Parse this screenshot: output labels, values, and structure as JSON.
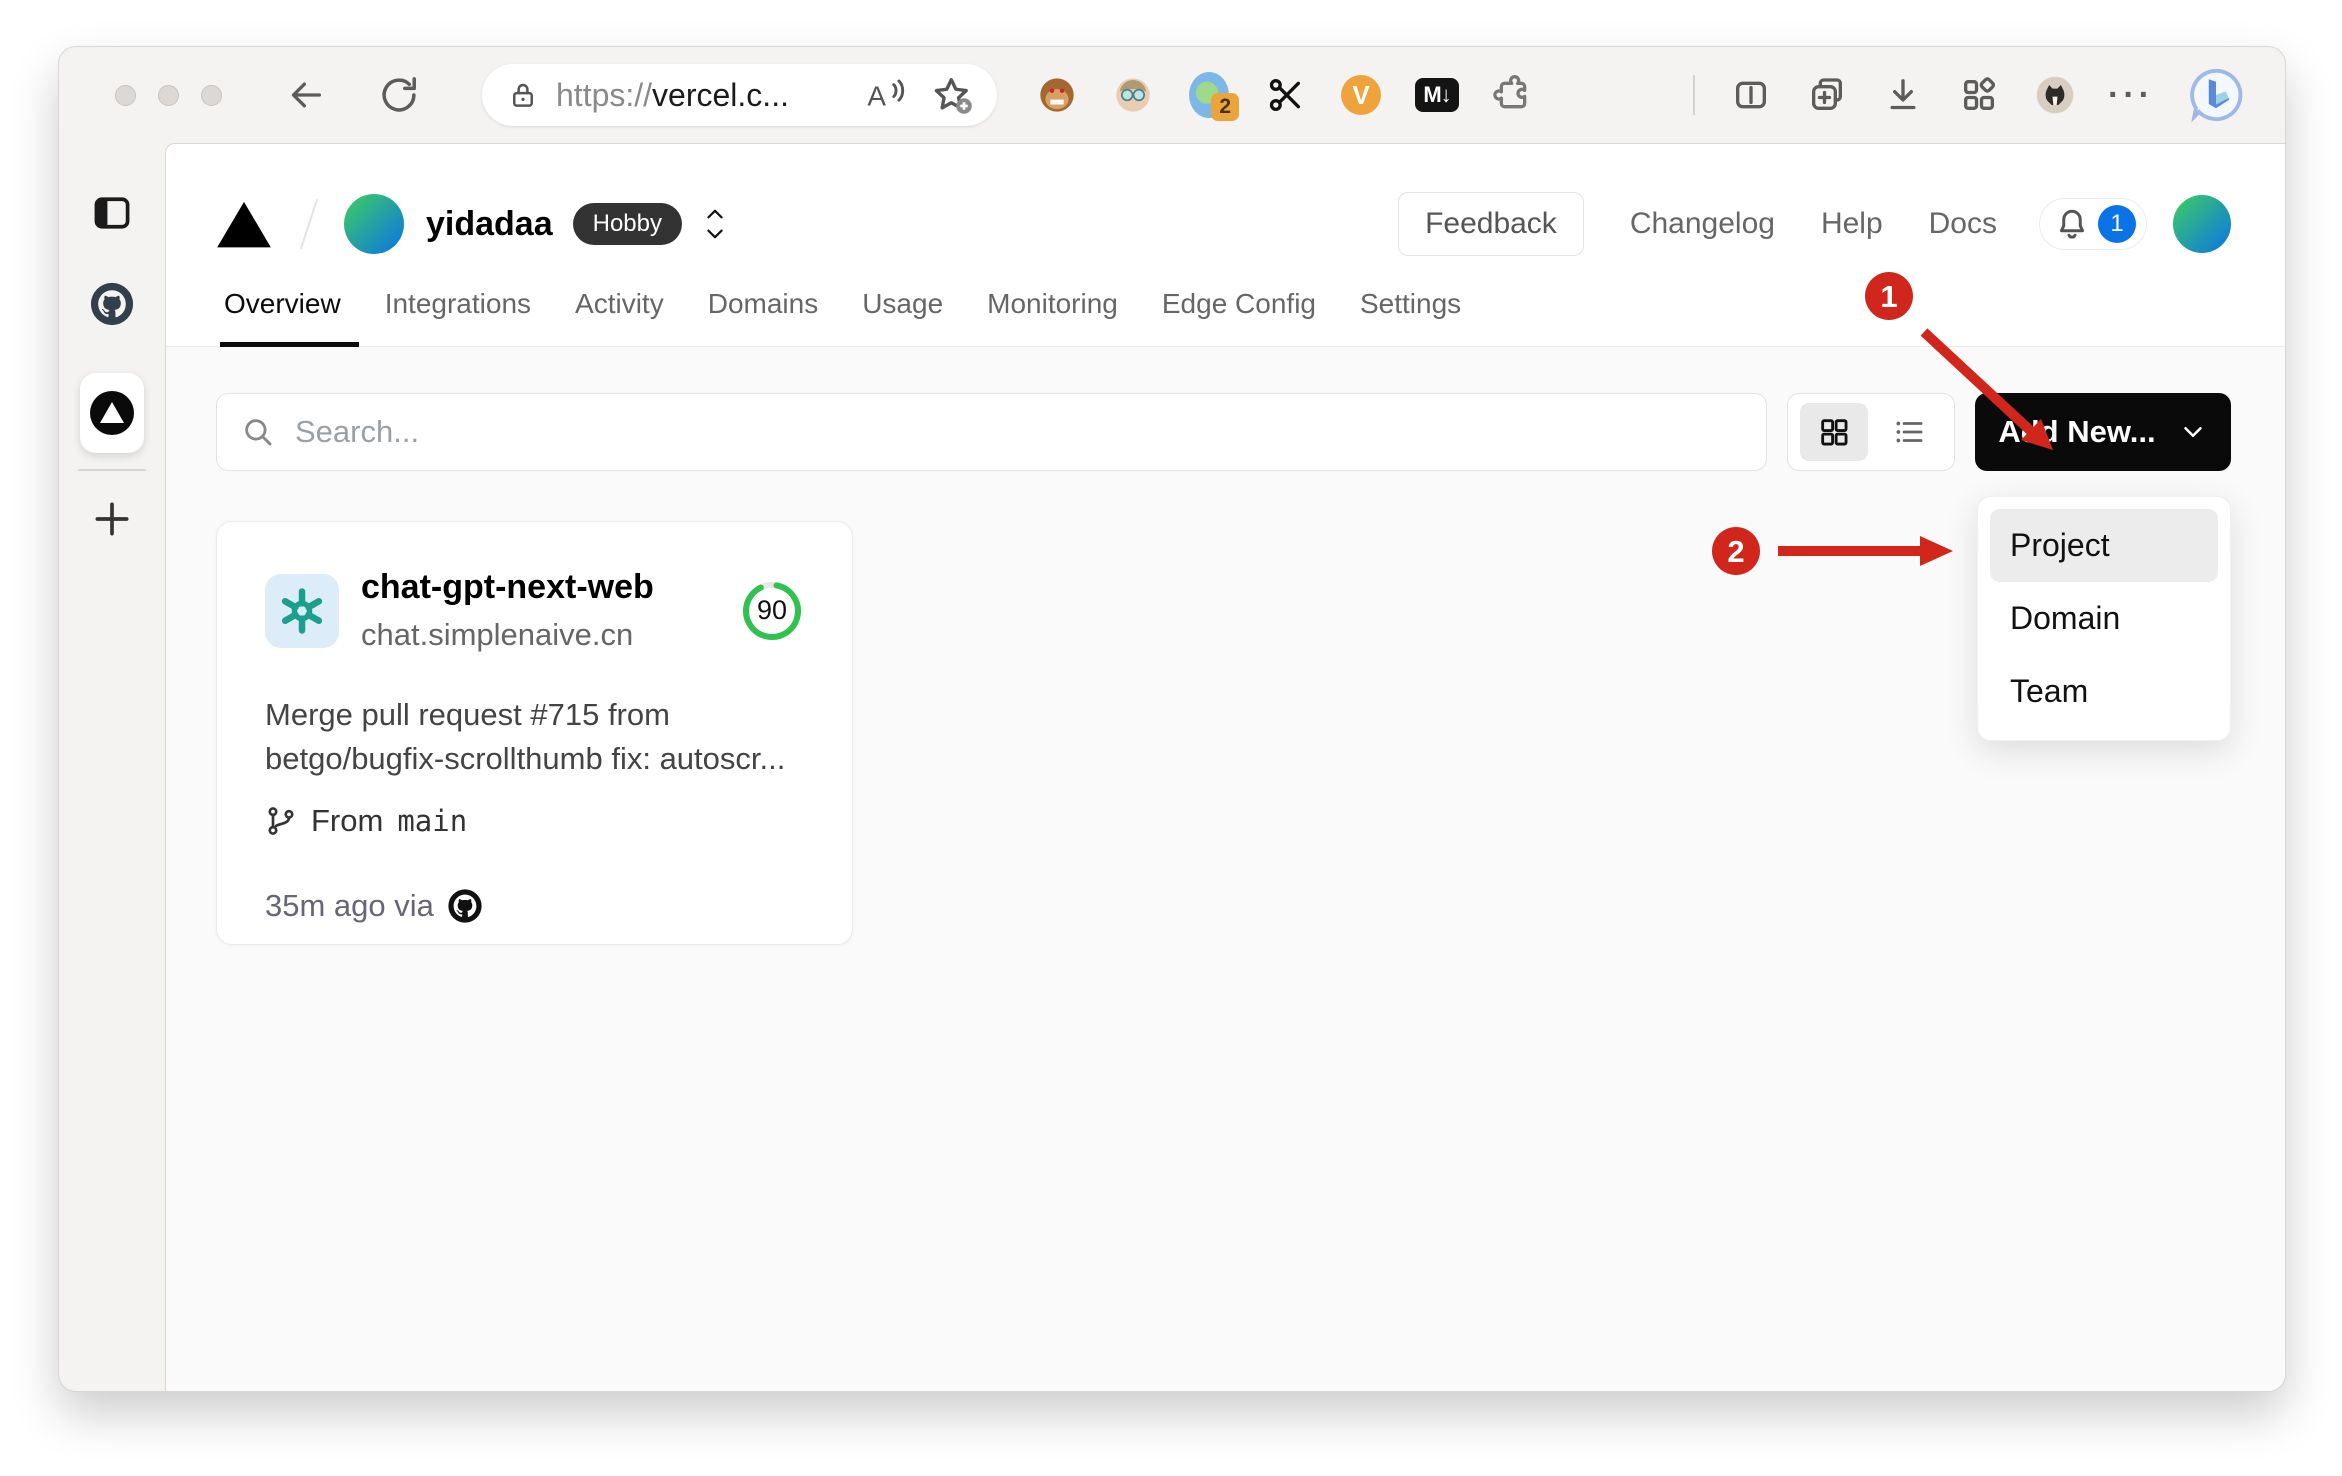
{
  "colors": {
    "annotation_red": "#d0261c",
    "notification_blue": "#0b72e7",
    "score_green": "#2fc24f",
    "openai_teal": "#1aa08c",
    "avatar_gradient_start": "#3ecf5e",
    "avatar_gradient_end": "#0b72e7"
  },
  "browser": {
    "url": {
      "scheme": "https://",
      "host": "vercel.c..."
    },
    "extensions": {
      "translate_badge": "2",
      "markdown_label": "M↓",
      "v_label": "V",
      "more_label": "···"
    }
  },
  "vercel": {
    "team": {
      "name": "yidadaa",
      "plan": "Hobby"
    },
    "header": {
      "feedback": "Feedback",
      "changelog": "Changelog",
      "help": "Help",
      "docs": "Docs",
      "notification_count": "1"
    },
    "tabs": [
      "Overview",
      "Integrations",
      "Activity",
      "Domains",
      "Usage",
      "Monitoring",
      "Edge Config",
      "Settings"
    ],
    "toolbar": {
      "search_placeholder": "Search...",
      "add_new_label": "Add New..."
    },
    "dropdown": [
      "Project",
      "Domain",
      "Team"
    ],
    "project_card": {
      "name": "chat-gpt-next-web",
      "domain": "chat.simplenaive.cn",
      "score": "90",
      "commit_message": "Merge pull request #715 from betgo/bugfix-scrollthumb fix: autoscr...",
      "branch_prefix": "From",
      "branch": "main",
      "meta": "35m ago via"
    },
    "annotations": {
      "step1": "1",
      "step2": "2"
    }
  }
}
